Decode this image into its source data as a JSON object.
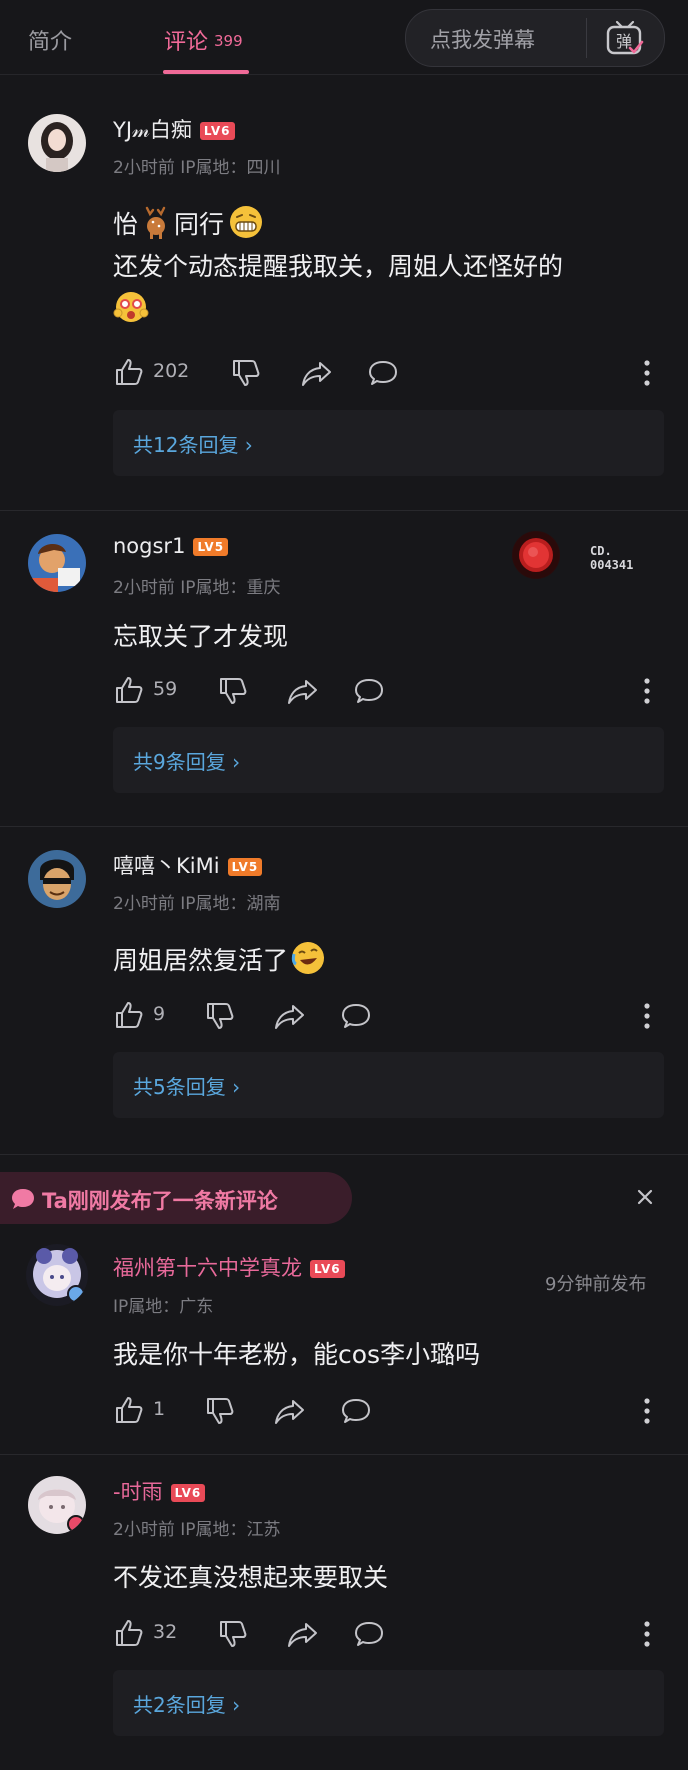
{
  "header": {
    "tab_intro": "简介",
    "tab_comments": "评论",
    "comment_count": "399",
    "danmaku_placeholder": "点我发弹幕",
    "danmaku_icon_text": "弹"
  },
  "comments": [
    {
      "username": "YJ𝓂白痴",
      "level": "LV6",
      "meta": "2小时前 IP属地：四川",
      "content_line1_a": "怡",
      "content_line1_b": "同行",
      "content_line2": "还发个动态提醒我取关，周姐人还怪好的",
      "likes": "202",
      "replies": "共12条回复 ›"
    },
    {
      "username": "nogsr1",
      "level": "LV5",
      "meta": "2小时前 IP属地：重庆",
      "content": "忘取关了才发现",
      "likes": "59",
      "replies": "共9条回复 ›",
      "badge_text_1": "CD.",
      "badge_text_2": "004341"
    },
    {
      "username": "嘻嘻丶KiMi",
      "level": "LV5",
      "meta": "2小时前 IP属地：湖南",
      "content": "周姐居然复活了",
      "likes": "9",
      "replies": "共5条回复 ›"
    },
    {
      "username": "福州第十六中学真龙",
      "level": "LV6",
      "meta": "IP属地：广东",
      "posted_time": "9分钟前发布",
      "content": "我是你十年老粉，能cos李小璐吗",
      "likes": "1"
    },
    {
      "username": "-时雨",
      "level": "LV6",
      "meta": "2小时前 IP属地：江苏",
      "content": "不发还真没想起来要取关",
      "likes": "32",
      "replies": "共2条回复 ›"
    }
  ],
  "notice": {
    "text": "Ta刚刚发布了一条新评论"
  },
  "colors": {
    "background": "#17171a",
    "accent_pink": "#f06a98",
    "reply_blue": "#5aa7dd",
    "lv6": "#e94a57",
    "lv5": "#f07b2a"
  }
}
